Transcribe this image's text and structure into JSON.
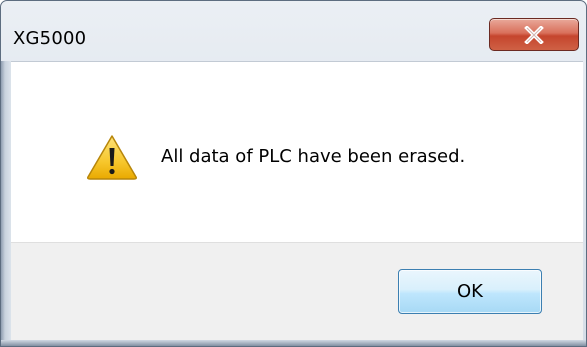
{
  "dialog": {
    "title": "XG5000",
    "message": "All data of PLC have been erased.",
    "ok_label": "OK",
    "icon": "warning-icon",
    "close_icon": "close-icon"
  },
  "colors": {
    "close_button": "#c5452d",
    "ok_button_border": "#3c7fb1",
    "warning_yellow": "#f7c72c",
    "footer_background": "#f0f0f0"
  }
}
